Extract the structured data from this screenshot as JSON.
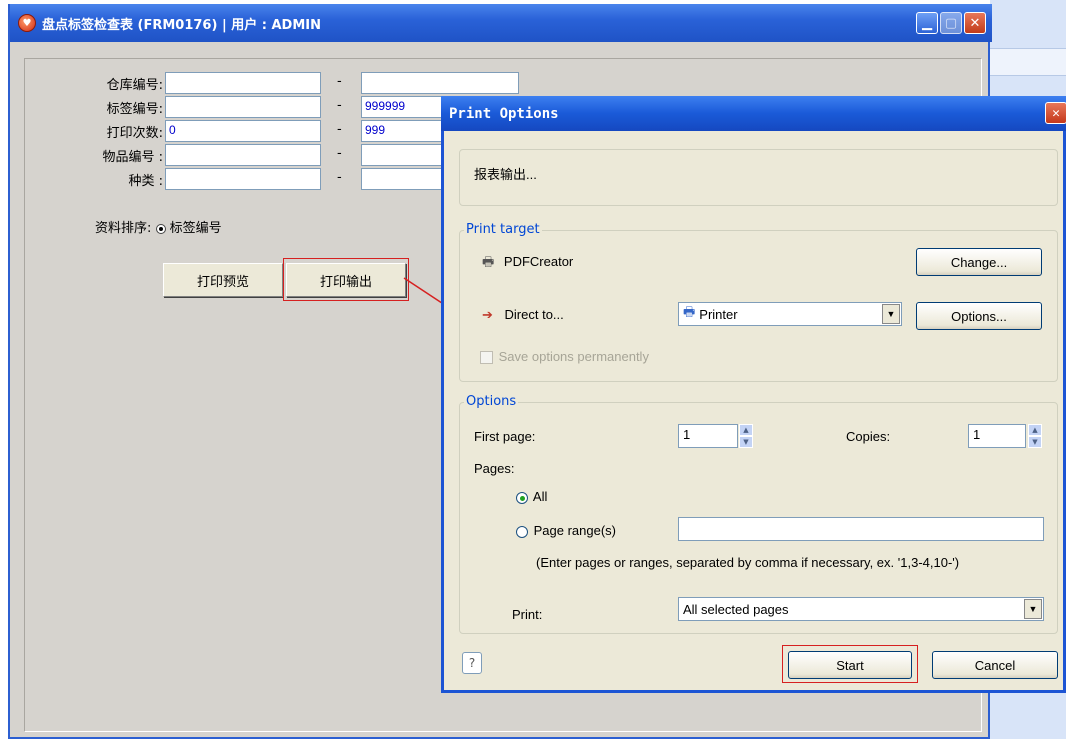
{
  "main_window": {
    "title": "盘点标签检查表 (FRM0176) | 用户 : ADMIN",
    "fields": [
      {
        "label": "仓库编号:",
        "from": "",
        "to": ""
      },
      {
        "label": "标签编号:",
        "from": "",
        "to": "999999"
      },
      {
        "label": "打印次数:",
        "from": "0",
        "to": "999"
      },
      {
        "label": "物品编号 :",
        "from": "",
        "to": ""
      },
      {
        "label": "种类 :",
        "from": "",
        "to": ""
      }
    ],
    "dash": "-",
    "sort_label": "资料排序:",
    "sort_option": "标签编号",
    "preview_button": "打印预览",
    "print_button": "打印输出"
  },
  "dialog": {
    "title": "Print Options",
    "report_text": "报表输出...",
    "print_target": {
      "group_title": "Print target",
      "printer_name": "PDFCreator",
      "change_button": "Change...",
      "direct_to_label": "Direct to...",
      "direct_to_value": "Printer",
      "options_button": "Options...",
      "save_options_label": "Save options permanently"
    },
    "options": {
      "group_title": "Options",
      "first_page_label": "First page:",
      "first_page_value": "1",
      "copies_label": "Copies:",
      "copies_value": "1",
      "pages_label": "Pages:",
      "all_label": "All",
      "page_range_label": "Page range(s)",
      "page_range_value": "",
      "hint": "(Enter pages or ranges, separated by comma if necessary, ex. '1,3-4,10-')",
      "print_label": "Print:",
      "print_value": "All selected pages"
    },
    "help_icon": "help-icon",
    "start_button": "Start",
    "cancel_button": "Cancel"
  },
  "colors": {
    "titlebar": "#2a62d8",
    "group_title": "#0046d5",
    "highlight_box": "#d62020",
    "input_text": "#0000cc"
  }
}
